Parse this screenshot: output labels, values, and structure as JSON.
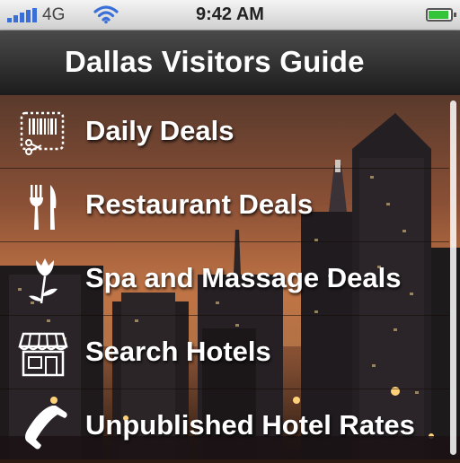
{
  "status_bar": {
    "carrier": "4G",
    "time": "9:42 AM",
    "battery_level": 0.9
  },
  "header": {
    "title": "Dallas Visitors Guide"
  },
  "menu": {
    "items": [
      {
        "label": "Daily Deals",
        "icon": "coupon-scissors-icon"
      },
      {
        "label": "Restaurant Deals",
        "icon": "fork-knife-icon"
      },
      {
        "label": "Spa and Massage Deals",
        "icon": "tulip-flower-icon"
      },
      {
        "label": "Search Hotels",
        "icon": "storefront-icon"
      },
      {
        "label": "Unpublished Hotel Rates",
        "icon": "phone-handset-icon"
      }
    ]
  },
  "colors": {
    "accent_signal": "#3a6fd8",
    "battery": "#33c43a"
  }
}
